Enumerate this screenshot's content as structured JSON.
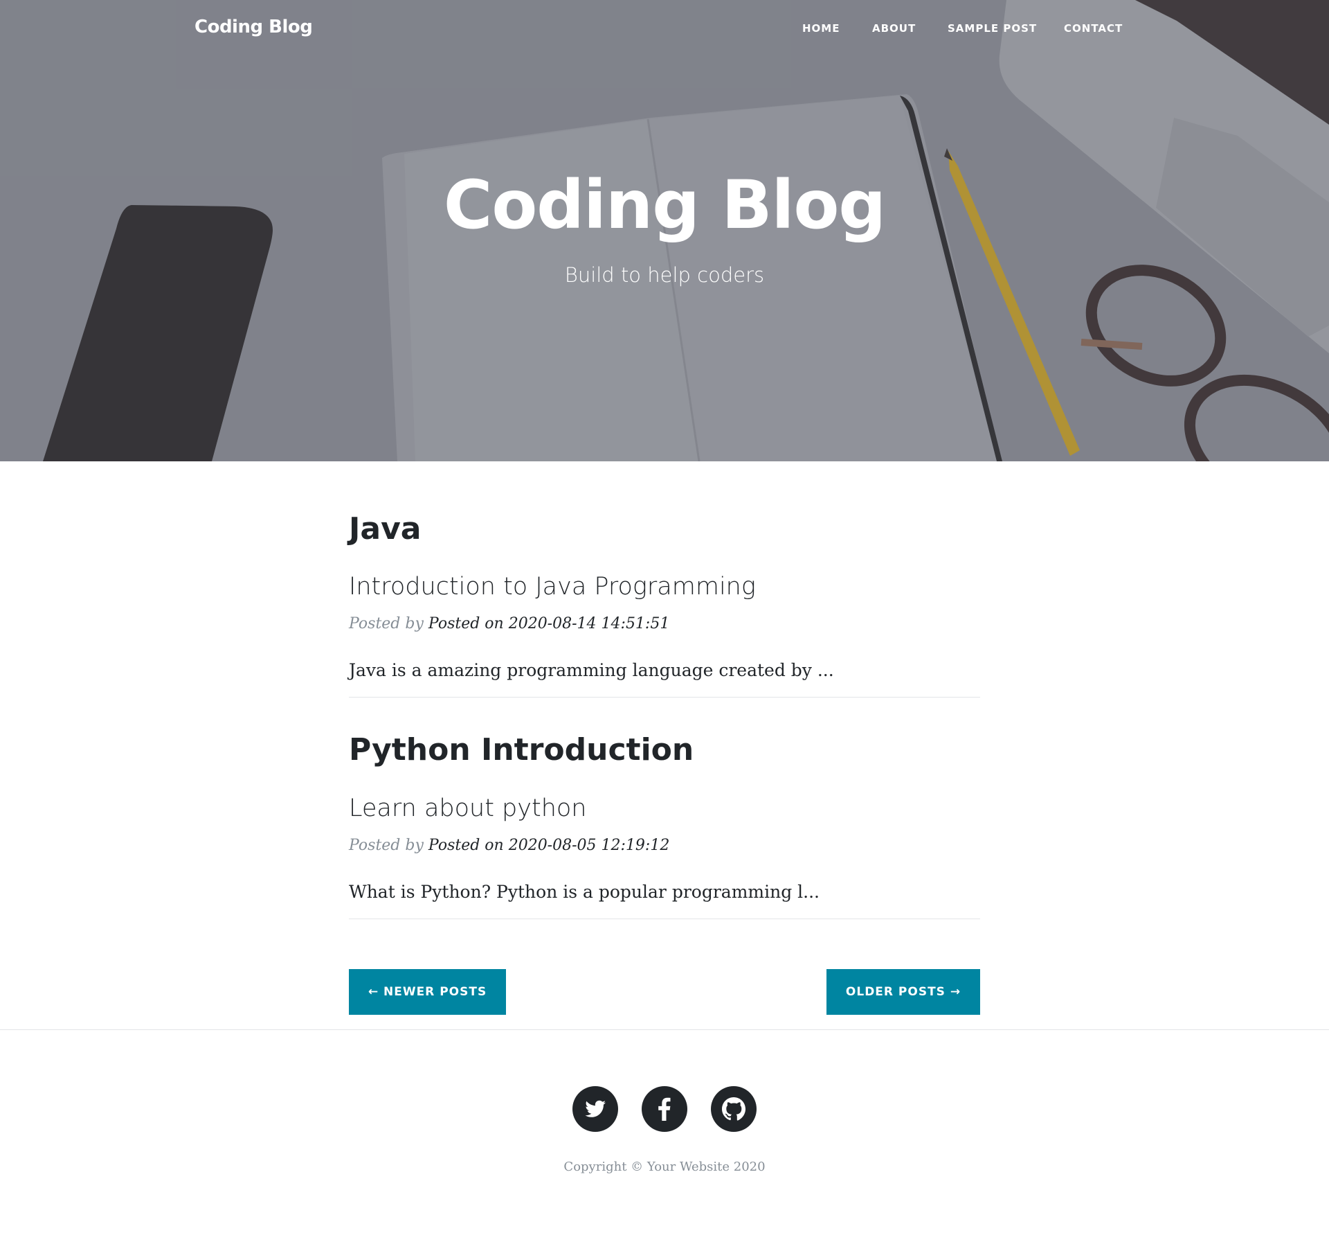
{
  "navbar": {
    "brand": "Coding Blog",
    "items": [
      {
        "label": "HOME"
      },
      {
        "label": "ABOUT"
      },
      {
        "label": "SAMPLE POST"
      },
      {
        "label": "CONTACT"
      }
    ]
  },
  "hero": {
    "title": "Coding Blog",
    "subtitle": "Build to help coders"
  },
  "posts": [
    {
      "title": "Java",
      "subtitle": "Introduction to Java Programming",
      "meta_prefix": "Posted by",
      "meta_detail": "Posted on 2020-08-14 14:51:51",
      "excerpt": "Java is a amazing programming language created by ..."
    },
    {
      "title": "Python Introduction",
      "subtitle": "Learn about python",
      "meta_prefix": "Posted by",
      "meta_detail": "Posted on 2020-08-05 12:19:12",
      "excerpt": "What is Python? Python is a popular programming l..."
    }
  ],
  "pager": {
    "newer_label": "← NEWER POSTS",
    "older_label": "OLDER POSTS →"
  },
  "footer": {
    "social": [
      {
        "icon": "twitter-icon"
      },
      {
        "icon": "facebook-icon"
      },
      {
        "icon": "github-icon"
      }
    ],
    "copyright": "Copyright © Your Website 2020"
  },
  "colors": {
    "accent": "#0085a1",
    "text": "#212529",
    "muted": "#868e96"
  }
}
